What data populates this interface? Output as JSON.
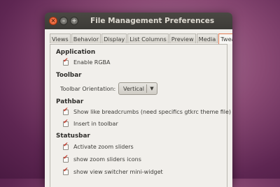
{
  "window": {
    "title": "File Management Preferences",
    "close_glyph": "×",
    "min_glyph": "–",
    "max_glyph": "+"
  },
  "tabs": [
    {
      "label": "Views"
    },
    {
      "label": "Behavior"
    },
    {
      "label": "Display"
    },
    {
      "label": "List Columns"
    },
    {
      "label": "Preview"
    },
    {
      "label": "Media"
    },
    {
      "label": "Tweaks",
      "active": true
    }
  ],
  "sections": {
    "application": {
      "title": "Application",
      "enable_rgba": {
        "label": "Enable RGBA",
        "checked": true
      }
    },
    "toolbar": {
      "title": "Toolbar",
      "orientation_label": "Toolbar Orientation:",
      "orientation_value": "Vertical"
    },
    "pathbar": {
      "title": "Pathbar",
      "breadcrumbs": {
        "label": "Show like breadcrumbs (need specifics gtkrc theme file)",
        "checked": true
      },
      "insert_toolbar": {
        "label": "Insert in toolbar",
        "checked": true
      }
    },
    "statusbar": {
      "title": "Statusbar",
      "zoom_sliders": {
        "label": "Activate zoom sliders",
        "checked": true
      },
      "zoom_icons": {
        "label": "show zoom sliders icons",
        "checked": true
      },
      "view_switcher": {
        "label": "show view switcher mini-widget",
        "checked": true
      }
    }
  },
  "colors": {
    "accent": "#e07a53",
    "check": "#c0392b",
    "titlebar": "#3c3b37"
  },
  "check_glyph": "✔"
}
